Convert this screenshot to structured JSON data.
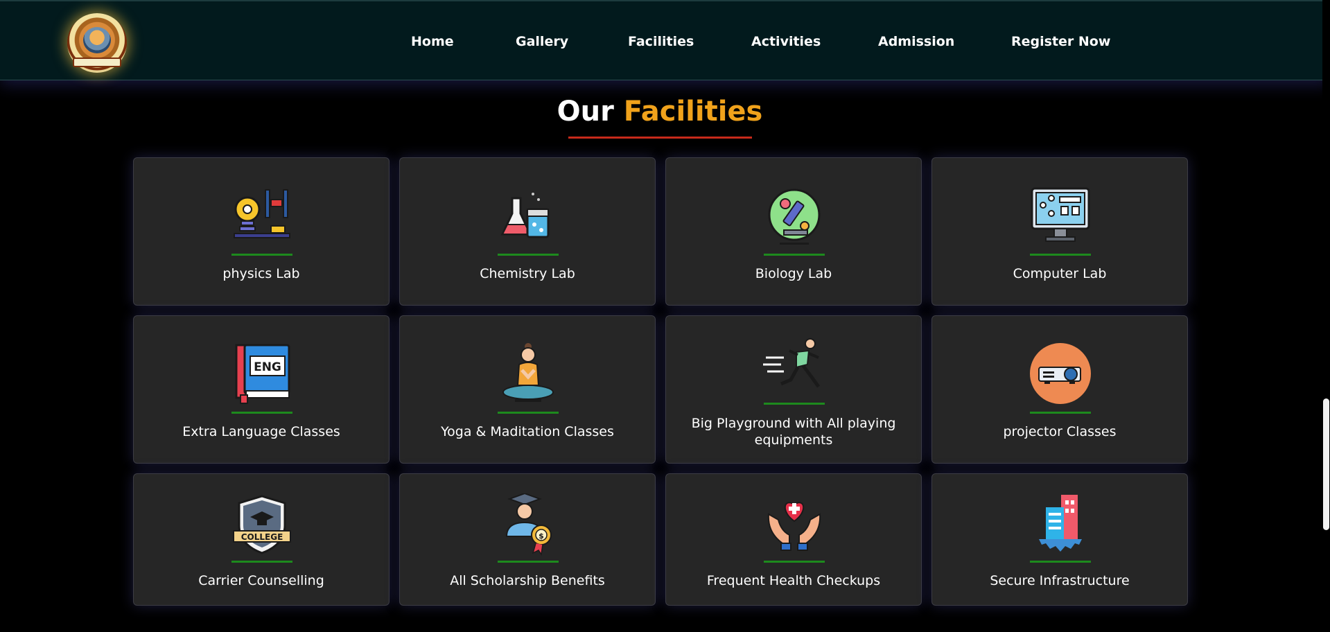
{
  "nav": {
    "logo_alt": "School emblem",
    "links": [
      "Home",
      "Gallery",
      "Facilities",
      "Activities",
      "Admission",
      "Register Now"
    ]
  },
  "section": {
    "title_main": "Our",
    "title_accent": "Facilities"
  },
  "colors": {
    "nav_bg": "#021a1d",
    "page_bg": "#000000",
    "card_bg": "#262626",
    "accent_orange": "#f0a21b",
    "underline_red": "#c72a1a",
    "card_line_green": "#1d8a1d"
  },
  "facilities": [
    {
      "label": "physics Lab",
      "icon": "physics-lab-icon"
    },
    {
      "label": "Chemistry Lab",
      "icon": "chemistry-flask-icon"
    },
    {
      "label": "Biology Lab",
      "icon": "biology-microscope-icon"
    },
    {
      "label": "Computer Lab",
      "icon": "computer-monitor-icon"
    },
    {
      "label": "Extra Language Classes",
      "icon": "language-book-icon",
      "icon_text": "ENG"
    },
    {
      "label": "Yoga & Maditation Classes",
      "icon": "yoga-meditation-icon"
    },
    {
      "label": "Big Playground with All playing equipments",
      "icon": "running-person-icon"
    },
    {
      "label": "projector Classes",
      "icon": "projector-icon"
    },
    {
      "label": "Carrier Counselling",
      "icon": "college-badge-icon",
      "icon_text": "COLLEGE"
    },
    {
      "label": "All Scholarship Benefits",
      "icon": "scholarship-graduate-icon"
    },
    {
      "label": "Frequent Health Checkups",
      "icon": "health-heart-hands-icon"
    },
    {
      "label": "Secure Infrastructure",
      "icon": "building-infrastructure-icon"
    }
  ]
}
